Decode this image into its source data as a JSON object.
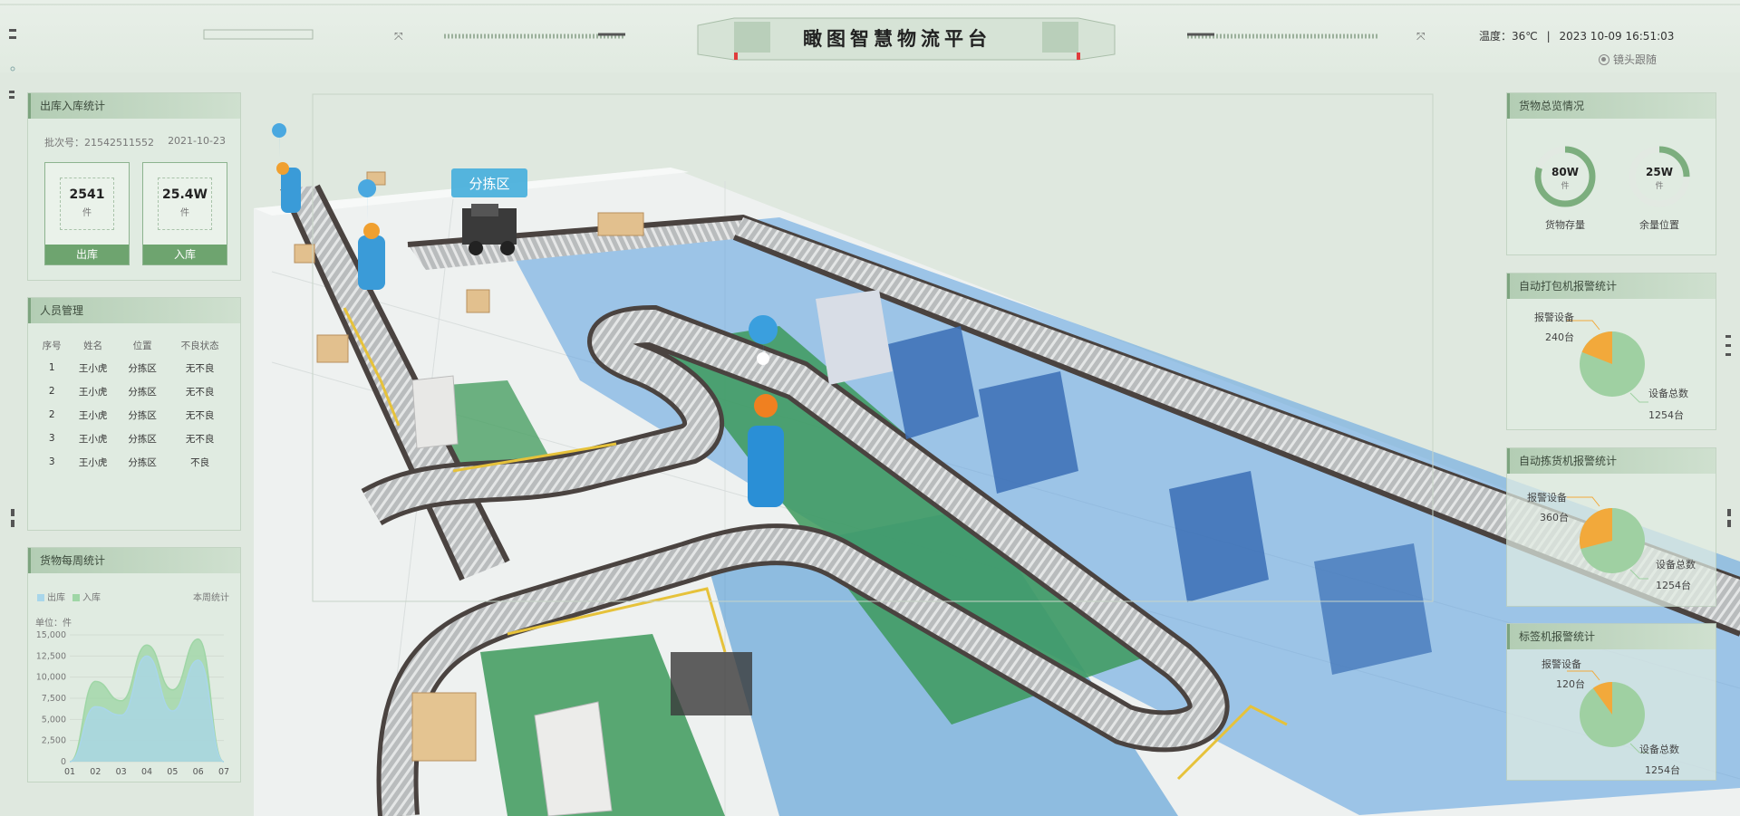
{
  "header": {
    "title": "瞰图智慧物流平台",
    "weather": "温度：36℃",
    "separator": "|",
    "datetime": "2023 10-09 16:51:03",
    "camera_follow": "镜头跟随"
  },
  "scene": {
    "zone_label": "分拣区"
  },
  "inout": {
    "title": "出库入库统计",
    "batch_label": "批次号：21542511552",
    "batch_date": "2021-10-23",
    "out": {
      "value": "2541",
      "unit": "件",
      "button": "出库"
    },
    "in": {
      "value": "25.4W",
      "unit": "件",
      "button": "入库"
    }
  },
  "staff": {
    "title": "人员管理",
    "columns": [
      "序号",
      "姓名",
      "位置",
      "不良状态"
    ],
    "rows": [
      {
        "id": "1",
        "name": "王小虎",
        "location": "分拣区",
        "status": "无不良"
      },
      {
        "id": "2",
        "name": "王小虎",
        "location": "分拣区",
        "status": "无不良"
      },
      {
        "id": "2",
        "name": "王小虎",
        "location": "分拣区",
        "status": "无不良"
      },
      {
        "id": "3",
        "name": "王小虎",
        "location": "分拣区",
        "status": "无不良"
      },
      {
        "id": "3",
        "name": "王小虎",
        "location": "分拣区",
        "status": "不良"
      }
    ]
  },
  "weekly": {
    "title": "货物每周统计",
    "legend_out": "出库",
    "legend_in": "入库",
    "period": "本周统计",
    "unit": "单位：件"
  },
  "chart_data": {
    "type": "area",
    "title": "货物每周统计",
    "categories": [
      "01",
      "02",
      "03",
      "04",
      "05",
      "06",
      "07"
    ],
    "ylim": [
      0,
      15000
    ],
    "yticks": [
      0,
      2500,
      5000,
      7500,
      10000,
      12500,
      15000
    ],
    "ytick_labels": [
      "0",
      "2,500",
      "5,000",
      "7,500",
      "10,000",
      "12,500",
      "15,000"
    ],
    "legend": "top-left",
    "series": [
      {
        "name": "入库",
        "color": "#9fd6a6",
        "values": [
          0,
          9500,
          7200,
          13800,
          8500,
          14500,
          0
        ]
      },
      {
        "name": "出库",
        "color": "#a9d6ea",
        "values": [
          0,
          6500,
          5500,
          12500,
          6000,
          12000,
          0
        ]
      }
    ]
  },
  "cargo": {
    "title": "货物总览情况",
    "stock": {
      "value": "80W",
      "unit": "件",
      "label": "货物存量",
      "fraction": 0.8,
      "color": "#7cae7e"
    },
    "free": {
      "value": "25W",
      "unit": "件",
      "label": "余量位置",
      "fraction": 0.25,
      "color": "#7cae7e"
    }
  },
  "alarms": [
    {
      "title": "自动打包机报警统计",
      "alarm_label": "报警设备",
      "alarm_value": "240台",
      "total_label": "设备总数",
      "total_value": "1254台",
      "alarm_fraction": 0.19
    },
    {
      "title": "自动拣货机报警统计",
      "alarm_label": "报警设备",
      "alarm_value": "360台",
      "total_label": "设备总数",
      "total_value": "1254台",
      "alarm_fraction": 0.29
    },
    {
      "title": "标签机报警统计",
      "alarm_label": "报警设备",
      "alarm_value": "120台",
      "total_label": "设备总数",
      "total_value": "1254台",
      "alarm_fraction": 0.1
    }
  ],
  "colors": {
    "accent": "#6ea46f",
    "conveyor": "#4a4340",
    "floor_blue": "#3f8fd3",
    "floor_green": "#3d9a5c",
    "alarm": "#f2a93b",
    "normal": "#9fd0a2"
  }
}
